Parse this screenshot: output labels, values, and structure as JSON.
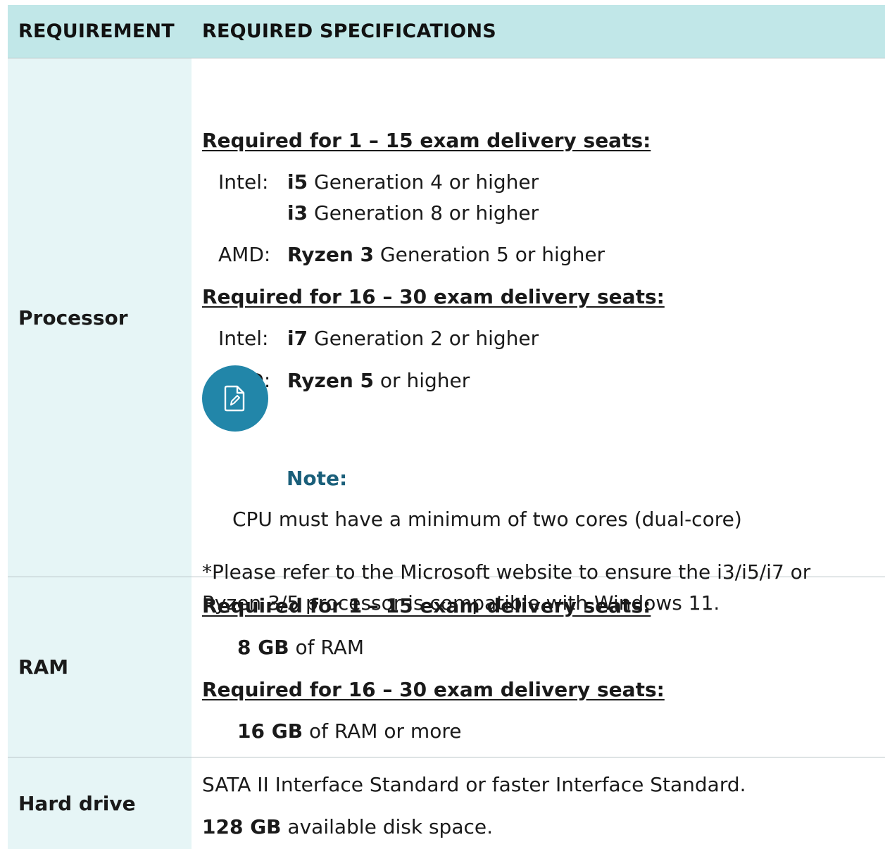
{
  "header": {
    "col1": "REQUIREMENT",
    "col2": "REQUIRED SPECIFICATIONS"
  },
  "processor": {
    "label": "Processor",
    "group1_heading": "Required for 1 – 15 exam delivery seats:",
    "intel_label": "Intel:",
    "intel_i5_model": "i5",
    "intel_i5_text": " Generation 4 or higher",
    "intel_i3_model": "i3",
    "intel_i3_text": " Generation 8 or higher",
    "amd_label": "AMD:",
    "amd_r3_model": "Ryzen 3",
    "amd_r3_text": " Generation 5 or higher",
    "group2_heading": "Required for 16 – 30 exam delivery seats:",
    "intel2_label": "Intel:",
    "intel_i7_model": "i7",
    "intel_i7_text": " Generation 2 or higher",
    "amd2_label": "AMD:",
    "amd_r5_model": "Ryzen 5",
    "amd_r5_text": " or higher",
    "note_title": "Note:",
    "note_text": "CPU must have a minimum of two cores (dual-core)",
    "footnote_line1": "*Please refer to the Microsoft website to ensure the i3/i5/i7 or",
    "footnote_line2": "Ryzen 3/5 processor is compatible with Windows 11."
  },
  "ram": {
    "label": "RAM",
    "group1_heading": "Required for 1 – 15 exam delivery seats:",
    "group1_value": "8 GB",
    "group1_text": " of RAM",
    "group2_heading": "Required for 16 – 30 exam delivery seats:",
    "group2_value": "16 GB",
    "group2_text": " of RAM or more"
  },
  "hard_drive": {
    "label": "Hard drive",
    "interface_text": "SATA II Interface Standard or faster Interface Standard.",
    "space_value": "128 GB",
    "space_text": " available disk space."
  },
  "icons": {
    "note_icon": "document-pen-icon"
  },
  "colors": {
    "header_bg": "#c1e7e8",
    "label_col_bg": "#e6f5f6",
    "note_circle": "#2286a9",
    "note_title": "#1a5f7a"
  }
}
